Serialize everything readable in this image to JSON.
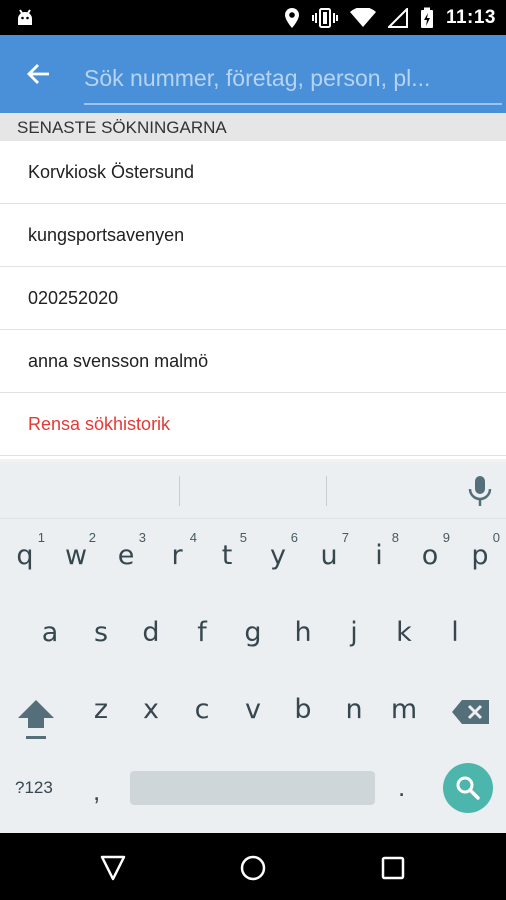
{
  "status_bar": {
    "time": "11:13",
    "icons": [
      "android-debug-icon",
      "location-icon",
      "vibrate-icon",
      "wifi-icon",
      "signal-icon",
      "battery-charging-icon"
    ]
  },
  "app_bar": {
    "search_placeholder": "Sök nummer, företag, person, pl...",
    "back_icon": "arrow-back-icon"
  },
  "recent": {
    "header": "SENASTE SÖKNINGARNA",
    "items": [
      "Korvkiosk Östersund",
      "kungsportsavenyen",
      "020252020",
      "anna svensson malmö"
    ],
    "clear_label": "Rensa sökhistorik"
  },
  "keyboard": {
    "row1": [
      "q",
      "w",
      "e",
      "r",
      "t",
      "y",
      "u",
      "i",
      "o",
      "p"
    ],
    "row1_nums": [
      "1",
      "2",
      "3",
      "4",
      "5",
      "6",
      "7",
      "8",
      "9",
      "0"
    ],
    "row2": [
      "a",
      "s",
      "d",
      "f",
      "g",
      "h",
      "j",
      "k",
      "l"
    ],
    "row3": [
      "z",
      "x",
      "c",
      "v",
      "b",
      "n",
      "m"
    ],
    "symbols_label": "?123",
    "comma": ",",
    "period": ".",
    "accent_color": "#4db6ac"
  },
  "nav_bar": {
    "icons": [
      "back-triangle-icon",
      "home-circle-icon",
      "recents-square-icon"
    ]
  }
}
